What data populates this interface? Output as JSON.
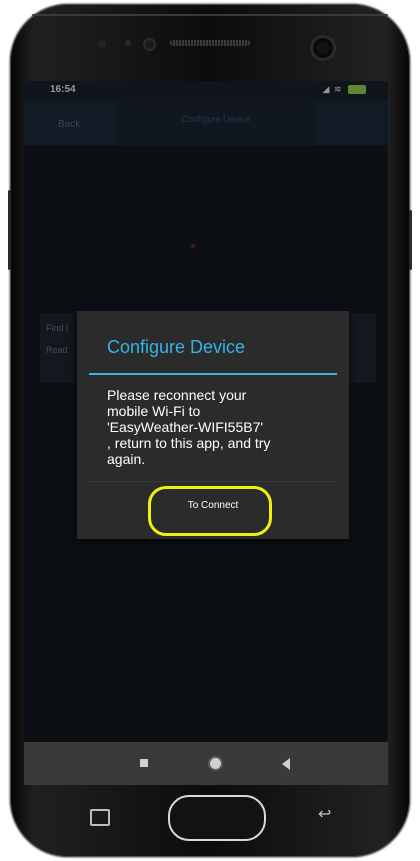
{
  "status_bar": {
    "time": "16:54",
    "time_suffix_icon": "wifi-sync-icon",
    "signal_icons": "◢ ≋"
  },
  "app_bar": {
    "back_label": "Back",
    "title": "Configure Device"
  },
  "background_panel": {
    "line1": "Find I",
    "line2": "Read"
  },
  "dialog": {
    "title": "Configure Device",
    "message": "Please reconnect your\nmobile Wi-Fi to\n'EasyWeather-WIFI55B7'\n, return to this app, and try\nagain.",
    "button_label": "To Connect"
  },
  "colors": {
    "accent": "#33b5e5",
    "highlight": "#f0f00e",
    "screen_bg": "#131921",
    "dialog_bg": "#2b2b2b"
  },
  "nav_bar": {
    "recent_icon": "square-icon",
    "home_icon": "circle-icon",
    "back_icon": "triangle-back-icon"
  }
}
